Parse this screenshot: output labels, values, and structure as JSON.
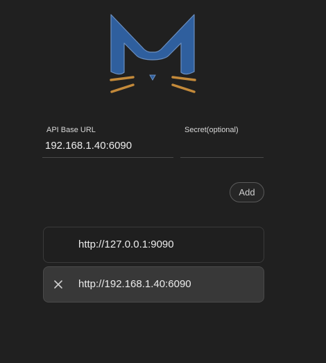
{
  "logo": {
    "name": "cat-m-logo-icon",
    "colors": {
      "letter": "#2f5f9e",
      "whiskers": "#c48a3a",
      "outline": "#6b8fc0"
    }
  },
  "form": {
    "api_base_url": {
      "label": "API Base URL",
      "value": "192.168.1.40:6090",
      "placeholder": ""
    },
    "secret": {
      "label": "Secret(optional)",
      "value": "",
      "placeholder": ""
    },
    "add_label": "Add"
  },
  "backends": [
    {
      "url": "http://127.0.0.1:9090",
      "selected": false
    },
    {
      "url": "http://192.168.1.40:6090",
      "selected": true,
      "action_icon": "close-icon"
    }
  ]
}
